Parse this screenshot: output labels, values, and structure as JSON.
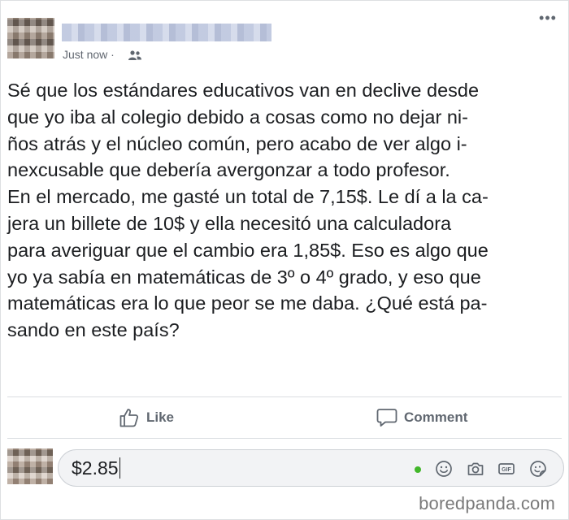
{
  "post": {
    "timestamp": "Just now · ",
    "audience_icon": "friends-icon",
    "more_icon": "more-options-icon",
    "text_lines": [
      "Sé que los estándares educativos van en declive desde",
      "que yo iba al colegio debido a cosas como no dejar ni-",
      "ños atrás y el núcleo común, pero acabo de ver algo i-",
      "nexcusable que debería avergonzar a todo profesor.",
      "En el mercado, me gasté un total de 7,15$. Le dí a la ca-",
      "jera un billete de 10$ y ella necesitó una calculadora",
      "para averiguar que el cambio era 1,85$. Eso es algo que",
      "yo ya sabía en matemáticas de 3º o 4º grado, y eso que",
      "matemáticas era lo que peor se me daba. ¿Qué está pa-",
      "sando en este país?"
    ]
  },
  "actions": {
    "like_label": "Like",
    "comment_label": "Comment"
  },
  "composer": {
    "value": "$2.85",
    "icons": [
      "emoji-icon",
      "camera-icon",
      "gif-icon",
      "sticker-icon"
    ],
    "gif_text": "GIF"
  },
  "watermark": "boredpanda.com",
  "colors": {
    "text": "#1c1e21",
    "secondary": "#606770",
    "online": "#42b72a",
    "composer_bg": "#f2f3f5"
  }
}
